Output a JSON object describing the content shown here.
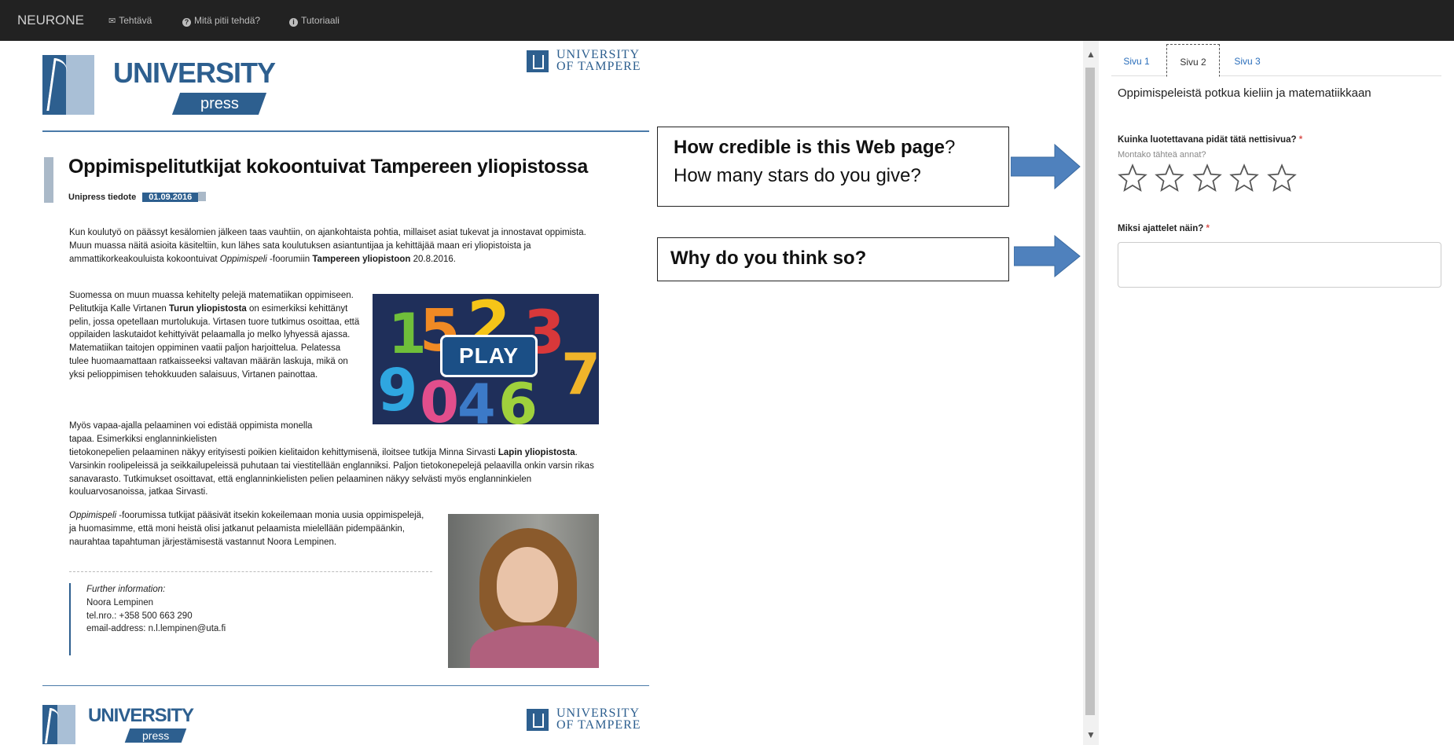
{
  "nav": {
    "brand": "NEURONE",
    "items": [
      {
        "label": "Tehtävä",
        "icon": "envelope-icon"
      },
      {
        "label": "Mitä pitii tehdä?",
        "icon": "question-circle-icon"
      },
      {
        "label": "Tutoriaali",
        "icon": "info-circle-icon"
      }
    ]
  },
  "article": {
    "publisher_logo": {
      "word": "UNIVERSITY",
      "sub": "press"
    },
    "uta_logo": {
      "line1": "UNIVERSITY",
      "line2": "OF TAMPERE"
    },
    "title": "Oppimispelitutkijat kokoontuivat Tampereen yliopistossa",
    "meta_label": "Unipress tiedote",
    "date": "01.09.2016",
    "p1": {
      "a": "Kun koulutyö on päässyt kesälomien jälkeen taas vauhtiin, on ajankohtaista pohtia, millaiset asiat tukevat ja innostavat oppimista. Muun muassa näitä asioita käsiteltiin, kun lähes sata koulutuksen asiantuntijaa ja kehittäjää maan eri yliopistoista ja ammattikorkeakouluista kokoontuivat ",
      "i": "Oppimispeli",
      "b": " -foorumiin ",
      "bold": "Tampereen yliopistoon",
      "c": " 20.8.2016."
    },
    "p2": {
      "a": "Suomessa on muun muassa kehitelty pelejä matematiikan oppimiseen. Pelitutkija Kalle Virtanen ",
      "bold": "Turun yliopistosta",
      "b": " on esimerkiksi kehittänyt pelin, jossa opetellaan murtolukuja. Virtasen tuore tutkimus osoittaa, että oppilaiden laskutaidot kehittyivät pelaamalla jo melko lyhyessä ajassa. Matematiikan taitojen oppiminen vaatii paljon harjoittelua. Pelatessa tulee huomaamattaan ratkaisseeksi valtavan määrän laskuja, mikä on yksi pelioppimisen tehokkuuden salaisuus, Virtanen painottaa."
    },
    "p3": {
      "a": "Myös vapaa-ajalla pelaaminen voi edistää oppimista monella tapaa. Esimerkiksi englanninkielisten",
      "b": "tietokonepelien pelaaminen näkyy erityisesti poikien kielitaidon kehittymisenä, iloitsee tutkija Minna Sirvasti ",
      "bold": "Lapin yliopistosta",
      "c": ". Varsinkin roolipeleissä ja seikkailupeleissä puhutaan tai viestitellään englanniksi. Paljon tietokonepelejä pelaavilla onkin varsin rikas sanavarasto. Tutkimukset osoittavat, että englanninkielisten pelien pelaaminen näkyy selvästi myös englanninkielen kouluarvosanoissa, jatkaa Sirvasti."
    },
    "p4": {
      "i": "Oppimispeli",
      "a": " -foorumissa tutkijat pääsivät itsekin kokeilemaan monia uusia oppimispelejä, ja huomasimme, että moni heistä olisi jatkanut pelaamista mielellään pidempäänkin, naurahtaa tapahtuman järjestämisestä vastannut Noora Lempinen."
    },
    "play_label": "PLAY",
    "contact": {
      "heading": "Further information:",
      "name": "Noora Lempinen",
      "phone": "tel.nro.: +358 500 663 290",
      "email": "email-address: n.l.lempinen@uta.fi"
    }
  },
  "callouts": {
    "credibility_bold": "How credible is this Web page",
    "credibility_rest": "?",
    "stars_question": "How many stars do you give?",
    "why_question": "Why do you think so?"
  },
  "sidebar": {
    "tabs": [
      "Sivu 1",
      "Sivu 2",
      "Sivu 3"
    ],
    "active_tab": "Sivu 2",
    "task_title": "Oppimispeleistä potkua kieliin ja matematiikkaan",
    "question1": "Kuinka luotettavana pidät tätä nettisivua?",
    "required_mark": "*",
    "question1_hint": "Montako tähteä annat?",
    "rating": {
      "max": 5,
      "value": 0
    },
    "question2": "Miksi ajattelet näin?",
    "answer_value": ""
  },
  "colors": {
    "accent": "#2d5f8f",
    "arrow": "#4f81bd",
    "navbar": "#222222",
    "link": "#2a6ebb",
    "required": "#d9534f"
  }
}
